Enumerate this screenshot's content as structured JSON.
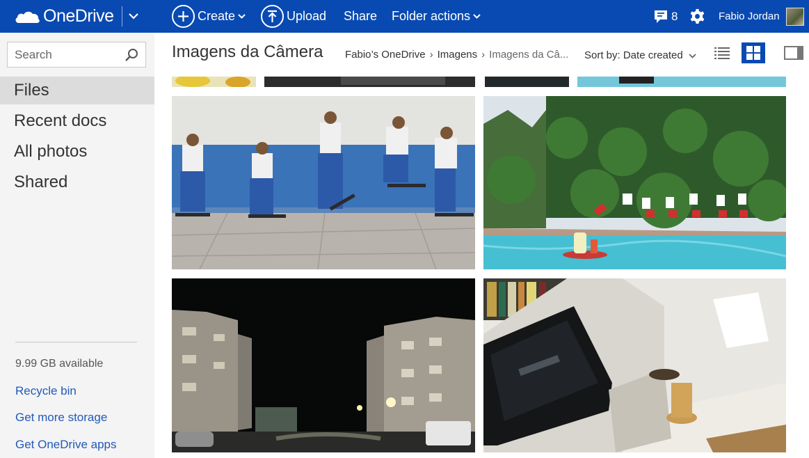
{
  "app": {
    "name": "OneDrive"
  },
  "toolbar": {
    "create_label": "Create",
    "upload_label": "Upload",
    "share_label": "Share",
    "folder_actions_label": "Folder actions",
    "notification_count": "8",
    "user_name": "Fabio Jordan"
  },
  "sidebar": {
    "search_placeholder": "Search",
    "items": [
      {
        "label": "Files",
        "active": true
      },
      {
        "label": "Recent docs",
        "active": false
      },
      {
        "label": "All photos",
        "active": false
      },
      {
        "label": "Shared",
        "active": false
      }
    ],
    "storage_available": "9.99 GB available",
    "links": [
      "Recycle bin",
      "Get more storage",
      "Get OneDrive apps"
    ]
  },
  "main": {
    "folder_title": "Imagens da Câmera",
    "breadcrumb": [
      "Fabio’s OneDrive",
      "Imagens",
      "Imagens da Câ..."
    ],
    "sort_label": "Sort by: Date created",
    "view_mode": "thumbnails",
    "photos": [
      {
        "subject": "skateboard-sequence"
      },
      {
        "subject": "pool-dive-sequence"
      },
      {
        "subject": "night-buildings"
      },
      {
        "subject": "living-room-tv"
      }
    ]
  },
  "colors": {
    "brand_blue": "#094ab2",
    "link_blue": "#2259b8",
    "rail_background": "#f4f4f4",
    "active_item": "#dcdcdc"
  },
  "icons": [
    "onedrive-cloud-icon",
    "chevron-down-icon",
    "plus-icon",
    "upload-arrow-icon",
    "notification-icon",
    "gear-icon",
    "search-icon",
    "list-view-icon",
    "thumbnail-view-icon",
    "details-pane-icon"
  ]
}
